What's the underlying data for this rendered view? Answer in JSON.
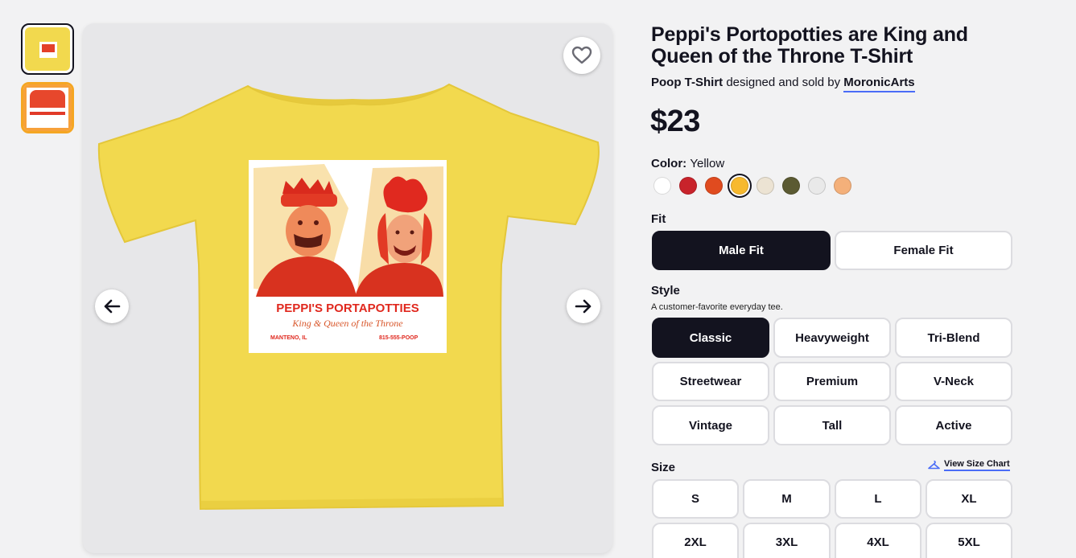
{
  "product": {
    "title": "Peppi's Portopotties are King and Queen of the Throne T-Shirt",
    "category": "Poop T-Shirt",
    "byline_mid": " designed and sold by ",
    "artist": "MoronicArts",
    "price": "$23"
  },
  "artwork": {
    "headline": "PEPPI'S PORTAPOTTIES",
    "script": "King & Queen of the Throne",
    "left": "MANTENO, IL",
    "right": "815-555-POOP"
  },
  "color": {
    "label": "Color:",
    "selected": "Yellow",
    "swatches": [
      {
        "name": "White",
        "hex": "#ffffff"
      },
      {
        "name": "Red",
        "hex": "#c8232b"
      },
      {
        "name": "Orange",
        "hex": "#e04b1f"
      },
      {
        "name": "Yellow",
        "hex": "#f7b92e"
      },
      {
        "name": "Natural",
        "hex": "#ece3d3"
      },
      {
        "name": "Olive",
        "hex": "#5b5a32"
      },
      {
        "name": "Heather",
        "hex": "#e9e9e9"
      },
      {
        "name": "Peach",
        "hex": "#f4b07a"
      }
    ]
  },
  "fit": {
    "label": "Fit",
    "options": [
      "Male Fit",
      "Female Fit"
    ],
    "selected": "Male Fit"
  },
  "style": {
    "label": "Style",
    "description": "A customer-favorite everyday tee.",
    "options": [
      "Classic",
      "Heavyweight",
      "Tri-Blend",
      "Streetwear",
      "Premium",
      "V-Neck",
      "Vintage",
      "Tall",
      "Active"
    ],
    "selected": "Classic"
  },
  "size": {
    "label": "Size",
    "chart_link": "View Size Chart",
    "options": [
      "S",
      "M",
      "L",
      "XL",
      "2XL",
      "3XL",
      "4XL",
      "5XL"
    ]
  },
  "icons": {
    "favorite": "heart-icon",
    "prev": "arrow-left-icon",
    "next": "arrow-right-icon",
    "size_chart": "hanger-icon"
  }
}
